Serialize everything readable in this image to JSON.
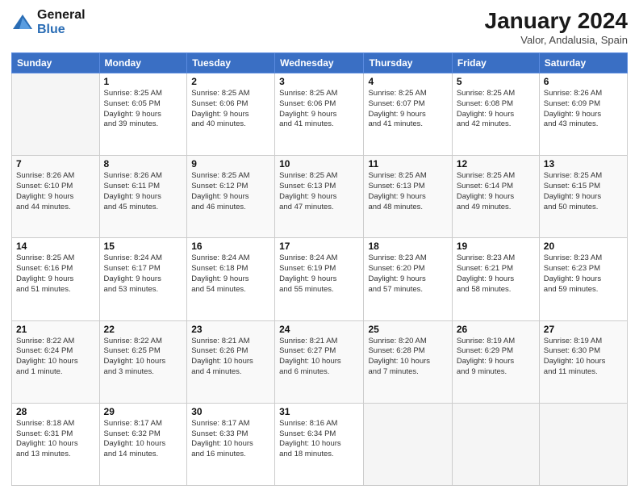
{
  "header": {
    "logo_general": "General",
    "logo_blue": "Blue",
    "month_title": "January 2024",
    "location": "Valor, Andalusia, Spain"
  },
  "days_of_week": [
    "Sunday",
    "Monday",
    "Tuesday",
    "Wednesday",
    "Thursday",
    "Friday",
    "Saturday"
  ],
  "weeks": [
    [
      {
        "num": "",
        "info": ""
      },
      {
        "num": "1",
        "info": "Sunrise: 8:25 AM\nSunset: 6:05 PM\nDaylight: 9 hours\nand 39 minutes."
      },
      {
        "num": "2",
        "info": "Sunrise: 8:25 AM\nSunset: 6:06 PM\nDaylight: 9 hours\nand 40 minutes."
      },
      {
        "num": "3",
        "info": "Sunrise: 8:25 AM\nSunset: 6:06 PM\nDaylight: 9 hours\nand 41 minutes."
      },
      {
        "num": "4",
        "info": "Sunrise: 8:25 AM\nSunset: 6:07 PM\nDaylight: 9 hours\nand 41 minutes."
      },
      {
        "num": "5",
        "info": "Sunrise: 8:25 AM\nSunset: 6:08 PM\nDaylight: 9 hours\nand 42 minutes."
      },
      {
        "num": "6",
        "info": "Sunrise: 8:26 AM\nSunset: 6:09 PM\nDaylight: 9 hours\nand 43 minutes."
      }
    ],
    [
      {
        "num": "7",
        "info": "Sunrise: 8:26 AM\nSunset: 6:10 PM\nDaylight: 9 hours\nand 44 minutes."
      },
      {
        "num": "8",
        "info": "Sunrise: 8:26 AM\nSunset: 6:11 PM\nDaylight: 9 hours\nand 45 minutes."
      },
      {
        "num": "9",
        "info": "Sunrise: 8:25 AM\nSunset: 6:12 PM\nDaylight: 9 hours\nand 46 minutes."
      },
      {
        "num": "10",
        "info": "Sunrise: 8:25 AM\nSunset: 6:13 PM\nDaylight: 9 hours\nand 47 minutes."
      },
      {
        "num": "11",
        "info": "Sunrise: 8:25 AM\nSunset: 6:13 PM\nDaylight: 9 hours\nand 48 minutes."
      },
      {
        "num": "12",
        "info": "Sunrise: 8:25 AM\nSunset: 6:14 PM\nDaylight: 9 hours\nand 49 minutes."
      },
      {
        "num": "13",
        "info": "Sunrise: 8:25 AM\nSunset: 6:15 PM\nDaylight: 9 hours\nand 50 minutes."
      }
    ],
    [
      {
        "num": "14",
        "info": "Sunrise: 8:25 AM\nSunset: 6:16 PM\nDaylight: 9 hours\nand 51 minutes."
      },
      {
        "num": "15",
        "info": "Sunrise: 8:24 AM\nSunset: 6:17 PM\nDaylight: 9 hours\nand 53 minutes."
      },
      {
        "num": "16",
        "info": "Sunrise: 8:24 AM\nSunset: 6:18 PM\nDaylight: 9 hours\nand 54 minutes."
      },
      {
        "num": "17",
        "info": "Sunrise: 8:24 AM\nSunset: 6:19 PM\nDaylight: 9 hours\nand 55 minutes."
      },
      {
        "num": "18",
        "info": "Sunrise: 8:23 AM\nSunset: 6:20 PM\nDaylight: 9 hours\nand 57 minutes."
      },
      {
        "num": "19",
        "info": "Sunrise: 8:23 AM\nSunset: 6:21 PM\nDaylight: 9 hours\nand 58 minutes."
      },
      {
        "num": "20",
        "info": "Sunrise: 8:23 AM\nSunset: 6:23 PM\nDaylight: 9 hours\nand 59 minutes."
      }
    ],
    [
      {
        "num": "21",
        "info": "Sunrise: 8:22 AM\nSunset: 6:24 PM\nDaylight: 10 hours\nand 1 minute."
      },
      {
        "num": "22",
        "info": "Sunrise: 8:22 AM\nSunset: 6:25 PM\nDaylight: 10 hours\nand 3 minutes."
      },
      {
        "num": "23",
        "info": "Sunrise: 8:21 AM\nSunset: 6:26 PM\nDaylight: 10 hours\nand 4 minutes."
      },
      {
        "num": "24",
        "info": "Sunrise: 8:21 AM\nSunset: 6:27 PM\nDaylight: 10 hours\nand 6 minutes."
      },
      {
        "num": "25",
        "info": "Sunrise: 8:20 AM\nSunset: 6:28 PM\nDaylight: 10 hours\nand 7 minutes."
      },
      {
        "num": "26",
        "info": "Sunrise: 8:19 AM\nSunset: 6:29 PM\nDaylight: 9 hours\nand 9 minutes."
      },
      {
        "num": "27",
        "info": "Sunrise: 8:19 AM\nSunset: 6:30 PM\nDaylight: 10 hours\nand 11 minutes."
      }
    ],
    [
      {
        "num": "28",
        "info": "Sunrise: 8:18 AM\nSunset: 6:31 PM\nDaylight: 10 hours\nand 13 minutes."
      },
      {
        "num": "29",
        "info": "Sunrise: 8:17 AM\nSunset: 6:32 PM\nDaylight: 10 hours\nand 14 minutes."
      },
      {
        "num": "30",
        "info": "Sunrise: 8:17 AM\nSunset: 6:33 PM\nDaylight: 10 hours\nand 16 minutes."
      },
      {
        "num": "31",
        "info": "Sunrise: 8:16 AM\nSunset: 6:34 PM\nDaylight: 10 hours\nand 18 minutes."
      },
      {
        "num": "",
        "info": ""
      },
      {
        "num": "",
        "info": ""
      },
      {
        "num": "",
        "info": ""
      }
    ]
  ]
}
